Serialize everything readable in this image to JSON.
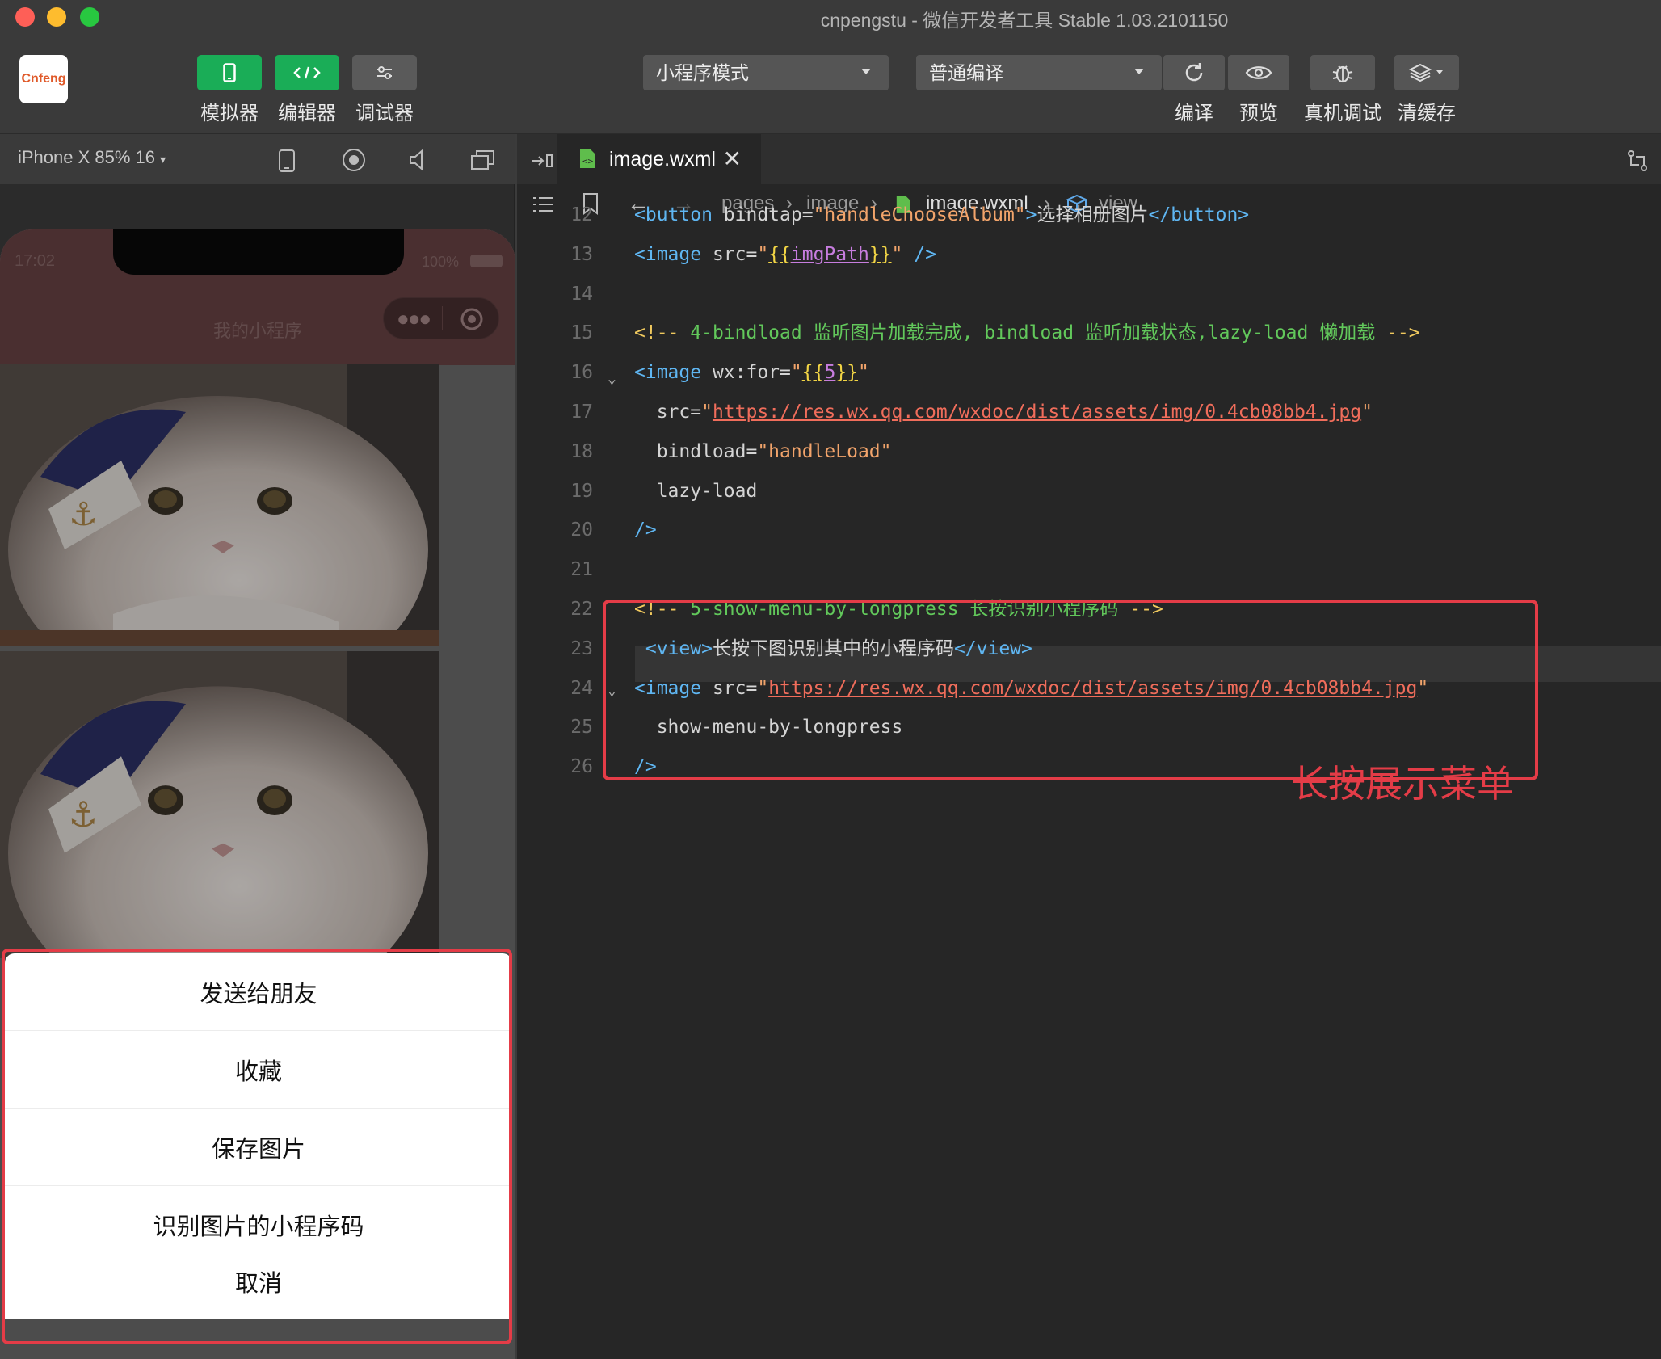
{
  "window": {
    "title": "cnpengstu - 微信开发者工具 Stable 1.03.2101150"
  },
  "toolbar": {
    "logo_text": "Cnfeng",
    "simulator_label": "模拟器",
    "editor_label": "编辑器",
    "debugger_label": "调试器",
    "mode_select": "小程序模式",
    "compile_select": "普通编译",
    "compile_label": "编译",
    "preview_label": "预览",
    "remote_debug_label": "真机调试",
    "clear_cache_label": "清缓存"
  },
  "simulator": {
    "device": "iPhone X 85% 16",
    "status_time": "17:02",
    "battery": "100%",
    "nav_title": "我的小程序",
    "action_sheet": {
      "items": [
        "发送给朋友",
        "收藏",
        "保存图片",
        "识别图片的小程序码"
      ],
      "cancel": "取消"
    }
  },
  "editor": {
    "tab_name": "image.wxml",
    "breadcrumb": [
      "pages",
      "image",
      "image.wxml",
      "view"
    ],
    "annotation": "长按展示菜单",
    "lines": [
      {
        "n": "12",
        "parts": [
          [
            "tagc",
            "<button "
          ],
          [
            "attr",
            "bindtap="
          ],
          [
            "str",
            "\"handleChooseAlbum\""
          ],
          [
            "tagc",
            ">"
          ],
          [
            "attr",
            "选择相册图片"
          ],
          [
            "tagc",
            "</button>"
          ]
        ]
      },
      {
        "n": "13",
        "parts": [
          [
            "tagc",
            "<image "
          ],
          [
            "attr",
            "src="
          ],
          [
            "str",
            "\""
          ],
          [
            "bt",
            "{{"
          ],
          [
            "bv",
            "imgPath"
          ],
          [
            "bt",
            "}}"
          ],
          [
            "str",
            "\""
          ],
          [
            "tagc",
            " />"
          ]
        ]
      },
      {
        "n": "14",
        "parts": []
      },
      {
        "n": "15",
        "parts": [
          [
            "cmk",
            "<!-- "
          ],
          [
            "cm",
            "4-bindload 监听图片加载完成, bindload 监听加载状态,lazy-load 懒加载 "
          ],
          [
            "cmk",
            "-->"
          ]
        ]
      },
      {
        "n": "16",
        "parts": [
          [
            "tagc",
            "<image "
          ],
          [
            "attr",
            "wx:for="
          ],
          [
            "str",
            "\""
          ],
          [
            "bt",
            "{{"
          ],
          [
            "bv",
            "5"
          ],
          [
            "bt",
            "}}"
          ],
          [
            "str",
            "\""
          ]
        ]
      },
      {
        "n": "17",
        "parts": [
          [
            "attr",
            "  src="
          ],
          [
            "str",
            "\""
          ],
          [
            "url",
            "https://res.wx.qq.com/wxdoc/dist/assets/img/0.4cb08bb4.jpg"
          ],
          [
            "str",
            "\""
          ]
        ]
      },
      {
        "n": "18",
        "parts": [
          [
            "attr",
            "  bindload="
          ],
          [
            "str",
            "\"handleLoad\""
          ]
        ]
      },
      {
        "n": "19",
        "parts": [
          [
            "attr",
            "  lazy-load"
          ]
        ]
      },
      {
        "n": "20",
        "parts": [
          [
            "tagc",
            "/>"
          ]
        ]
      },
      {
        "n": "21",
        "parts": []
      },
      {
        "n": "22",
        "parts": [
          [
            "cmk",
            "<!-- "
          ],
          [
            "cm",
            "5-show-menu-by-longpress 长按识别小程序码 "
          ],
          [
            "cmk",
            "-->"
          ]
        ]
      },
      {
        "n": "23",
        "parts": [
          [
            "tagc",
            " <view>"
          ],
          [
            "attr",
            "长按下图识别其中的小程序码"
          ],
          [
            "tagc",
            "</view>"
          ]
        ]
      },
      {
        "n": "24",
        "parts": [
          [
            "tagc",
            "<image "
          ],
          [
            "attr",
            "src="
          ],
          [
            "str",
            "\""
          ],
          [
            "url",
            "https://res.wx.qq.com/wxdoc/dist/assets/img/0.4cb08bb4.jpg"
          ],
          [
            "str",
            "\""
          ]
        ]
      },
      {
        "n": "25",
        "parts": [
          [
            "attr",
            "  show-menu-by-longpress"
          ]
        ]
      },
      {
        "n": "26",
        "parts": [
          [
            "tagc",
            "/>"
          ]
        ]
      }
    ]
  },
  "colors": {
    "accent_green": "#1aad57",
    "annotation_red": "#e43c47"
  }
}
